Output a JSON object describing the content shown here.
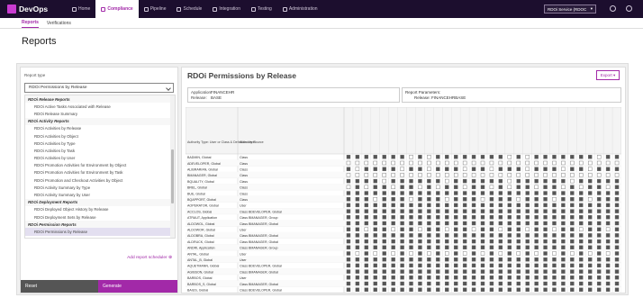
{
  "app": {
    "name": "DevOps"
  },
  "nav": [
    {
      "label": "Home",
      "active": false
    },
    {
      "label": "Compliance",
      "active": true
    },
    {
      "label": "Pipeline",
      "active": false
    },
    {
      "label": "Schedule",
      "active": false
    },
    {
      "label": "Integration",
      "active": false
    },
    {
      "label": "Testing",
      "active": false
    },
    {
      "label": "Administration",
      "active": false
    }
  ],
  "environment": "RDOi Service (RDOC",
  "subtabs": [
    {
      "label": "Reports",
      "active": true
    },
    {
      "label": "Verifications",
      "active": false
    }
  ],
  "page_title": "Reports",
  "left": {
    "report_type_label": "Report type",
    "report_type_value": "RDOi Permissions by Release",
    "groups": [
      {
        "title": "RDOi Release Reports",
        "items": [
          "RDOi Active Tasks Associated with Release",
          "RDOi Release Summary"
        ]
      },
      {
        "title": "RDOi Activity Reports",
        "items": [
          "RDOi Activities by Release",
          "RDOi Activities by Object",
          "RDOi Activities by Type",
          "RDOi Activities by Task",
          "RDOi Activities by User",
          "RDOi Promotion Activities for Environment by Object",
          "RDOi Promotion Activities for Environment by Task",
          "RDOi Promotion and Checkout Activities by Object",
          "RDOi Activity Summary by Type",
          "RDOi Activity Summary by User"
        ]
      },
      {
        "title": "RDOi Deployment Reports",
        "items": [
          "RDOi Deployed Object History by Release",
          "RDOi Deployment Sets by Release"
        ]
      },
      {
        "title": "RDOi Permission Reports",
        "items": [
          "RDOi Permissions by Release"
        ]
      }
    ],
    "selected_item": "RDOi Permissions by Release",
    "add_scheduler": "Add report scheduler",
    "reset_label": "Reset",
    "generate_label": "Generate"
  },
  "report": {
    "title": "RDOi Permissions by Release",
    "export_label": "Export",
    "application_label": "Application:",
    "application_value": "FINANCEHR",
    "release_label": "Release:",
    "release_value": "BASE",
    "parameters_label": "Report Parameters:",
    "parameters_value": "Release: FINANCEHRBASE",
    "col_authority_type": "Authority Type: User or Class & Definition Level",
    "col_authority_source": "Authority Source"
  },
  "grid": {
    "rows": [
      [
        "BADMIN, Global",
        "Class",
        "1111111010111111110101111111011"
      ],
      [
        "ADEVELOPER, Global",
        "Class",
        "0000000000000000000000000000000"
      ],
      [
        "ALIBRARIAN, Global",
        "Class",
        "1011110110111011011101110110111"
      ],
      [
        "BMANAGER, Global",
        "Class",
        "0000000000000000000000000000000"
      ],
      [
        "BQUALITY, Global",
        "Class",
        "1111011111101111110111111011111"
      ],
      [
        "BREL, Global",
        "Class",
        "0101101101011011010110110101101"
      ],
      [
        "BUE, Global",
        "Class",
        "1111111111111111111111111111111"
      ],
      [
        "BQAPPORT, Global",
        "Class",
        "1110111011101110111011101110111"
      ],
      [
        "AOPERATOR, Global",
        "User",
        "1111111111111111111111111111111"
      ],
      [
        "ACCLOS, Global",
        "Class BDEVELOPER, Global",
        "1111111111111111111111111111111"
      ],
      [
        "ATRAUT, Application",
        "Class BMANAGER, Group",
        "1111111111111111111111111111111"
      ],
      [
        "ALDOWOL, Global",
        "Class BMANAGER, Global",
        "1111111111111111111111111111111"
      ],
      [
        "ALDOWOR, Global",
        "User",
        "1101101101101101101101101101101"
      ],
      [
        "ALDOBRA, Global",
        "Class BMANAGER, Global",
        "1111111111111111111111111111111"
      ],
      [
        "ALDRUCK, Global",
        "Class BMANAGER, Global",
        "1111111111111111111111111111111"
      ],
      [
        "ANDRI, Application",
        "Class BMANAGER, Group",
        "1111111111111111111111111111111"
      ],
      [
        "ANTAL, Global",
        "User",
        "1010101010101010101010101010101"
      ],
      [
        "ANTAL_B, Global",
        "User",
        "1111111111111111111111111111111"
      ],
      [
        "AQUETMANN, Global",
        "Class BDEVELOPER, Global",
        "1111111111111111111111111111111"
      ],
      [
        "AGIBSON, Global",
        "Class BMANAGER, Global",
        "1111111111111111111111111111111"
      ],
      [
        "BARBOS, Global",
        "User",
        "1111111111111111111111111111111"
      ],
      [
        "BARBOS_S, Global",
        "Class BMANAGER, Global",
        "1111111111111111111111111111111"
      ],
      [
        "BAIUS, Global",
        "Class BDEVELOPER, Global",
        "1111111111111111111111111111111"
      ]
    ]
  }
}
